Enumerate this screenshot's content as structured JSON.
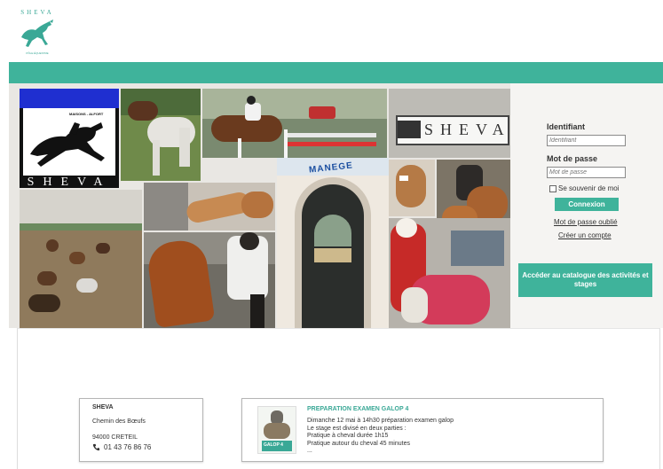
{
  "logo": {
    "title": "SHEVA",
    "tagline": "PÔLE ÉQUESTRE"
  },
  "collage": {
    "sheva_sign_a": "SHEVA",
    "maisons_alfort": "MAISONS - ALFORT",
    "sheva_sign_b": "SHEVA",
    "manege_sign": "MANEGE"
  },
  "login": {
    "identifiant_label": "Identifiant",
    "identifiant_placeholder": "Identifiant",
    "password_label": "Mot de passe",
    "password_placeholder": "Mot de passe",
    "remember_label": "Se souvenir de moi",
    "connect_button": "Connexion",
    "forgot_link": "Mot de passe oublié",
    "create_link": "Créer un compte",
    "catalog_button": "Accéder au catalogue des activités et stages"
  },
  "address": {
    "name": "SHEVA",
    "street": "Chemin des Bœufs",
    "city": "94000 CRETEIL",
    "phone": "01 43 76 86 76",
    "phone_icon": "phone-icon"
  },
  "news": {
    "title": "PREPARATION EXAMEN GALOP 4",
    "lines": [
      "Dimanche 12 mai à 14h30 préparation examen galop",
      "Le stage est divisé en deux parties :",
      "Pratique à cheval durée 1h15",
      "Pratique autour du cheval 45 minutes",
      "..."
    ],
    "thumb_label": "GALOP 4"
  },
  "colors": {
    "accent": "#3fb39b",
    "accent_text": "#3aa896"
  }
}
